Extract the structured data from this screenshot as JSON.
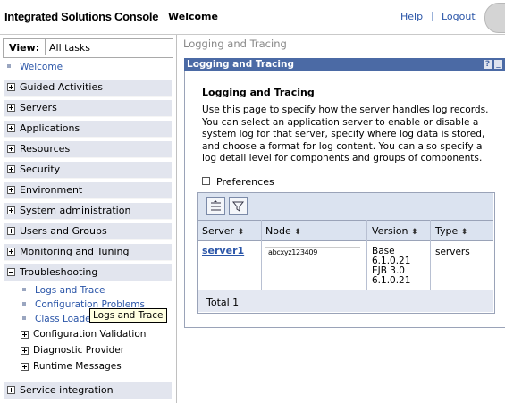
{
  "header": {
    "app_title": "Integrated Solutions Console",
    "welcome": "Welcome",
    "help": "Help",
    "separator": "|",
    "logout": "Logout"
  },
  "nav": {
    "view_label": "View:",
    "view_value": "All tasks",
    "welcome_link": "Welcome",
    "sections": {
      "guided": "Guided Activities",
      "servers": "Servers",
      "applications": "Applications",
      "resources": "Resources",
      "security": "Security",
      "environment": "Environment",
      "sysadmin": "System administration",
      "users": "Users and Groups",
      "monitoring": "Monitoring and Tuning",
      "troubleshooting": "Troubleshooting",
      "service": "Service integration"
    },
    "troubleshooting_items": {
      "logs": "Logs and Trace",
      "config": "Configuration Problems",
      "classload": "Class Loade"
    },
    "sub_sections": {
      "config_validation": "Configuration Validation",
      "diagnostic": "Diagnostic Provider",
      "runtime": "Runtime Messages"
    },
    "tooltip": "Logs and Trace"
  },
  "main": {
    "breadcrumb": "Logging and Tracing",
    "panel_title": "Logging and Tracing",
    "panel_help": "?",
    "panel_min": "_",
    "content_title": "Logging and Tracing",
    "description": "Use this page to specify how the server handles log records. You can select an application server to enable or disable a system log for that server, specify where log data is stored, and choose a format for log content. You can also specify a log detail level for components and groups of components.",
    "preferences": "Preferences",
    "table": {
      "headers": {
        "server": "Server",
        "node": "Node",
        "version": "Version",
        "type": "Type"
      },
      "row": {
        "server": "server1",
        "node": "abcxyz123409",
        "version_lines": [
          "Base",
          "6.1.0.21",
          "EJB 3.0",
          "6.1.0.21"
        ],
        "type": "servers"
      },
      "total": "Total 1"
    }
  },
  "colors": {
    "accent": "#4b6aa5",
    "link": "#2a55a8",
    "nav_section_bg": "#e2e5ee"
  }
}
